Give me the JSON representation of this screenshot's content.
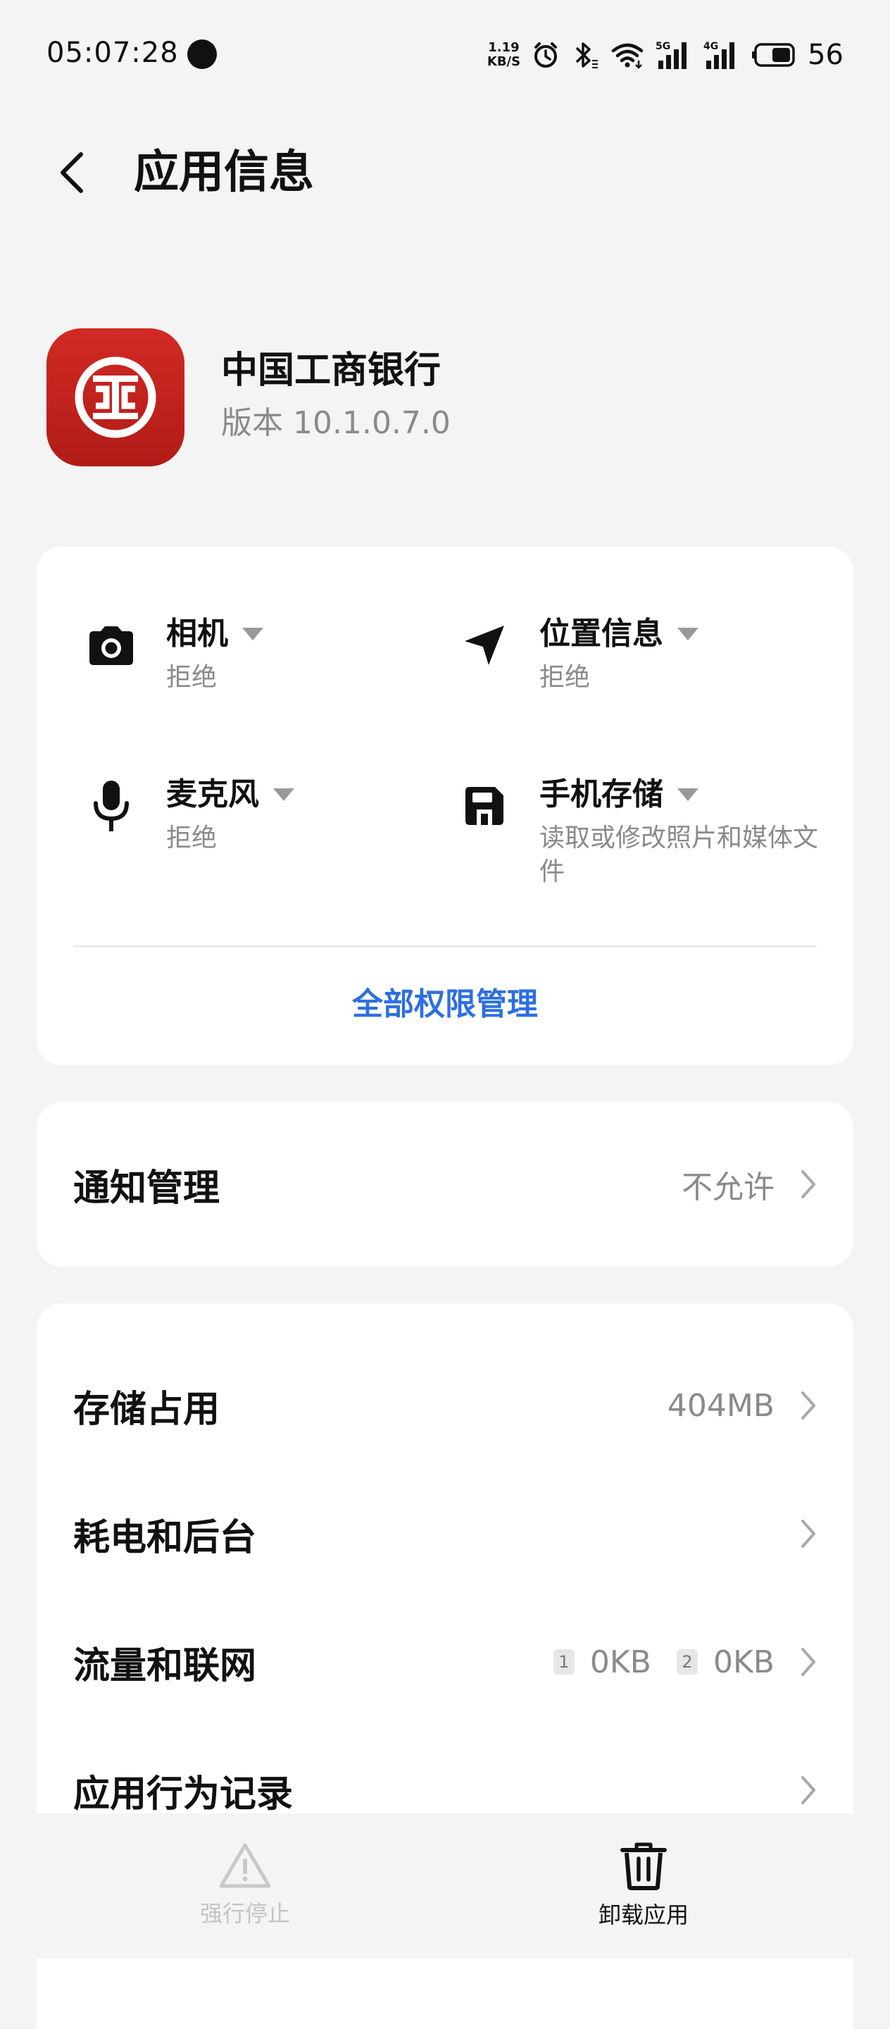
{
  "status_bar": {
    "time": "05:07:28",
    "net_speed_value": "1.19",
    "net_speed_unit": "KB/S",
    "signal1_label": "5G",
    "signal2_label": "4G",
    "battery": "56"
  },
  "header": {
    "title": "应用信息"
  },
  "app": {
    "name": "中国工商银行",
    "version": "版本 10.1.0.7.0"
  },
  "permissions": {
    "items": [
      {
        "name": "相机",
        "status": "拒绝",
        "icon": "camera-icon"
      },
      {
        "name": "位置信息",
        "status": "拒绝",
        "icon": "location-icon"
      },
      {
        "name": "麦克风",
        "status": "拒绝",
        "icon": "microphone-icon"
      },
      {
        "name": "手机存储",
        "status": "读取或修改照片和媒体文件",
        "icon": "storage-icon"
      }
    ],
    "manage_all_label": "全部权限管理"
  },
  "notification": {
    "label": "通知管理",
    "value": "不允许"
  },
  "settings": {
    "storage_label": "存储占用",
    "storage_value": "404MB",
    "battery_label": "耗电和后台",
    "traffic_label": "流量和联网",
    "sim1": "1",
    "sim1_value": "0KB",
    "sim2": "2",
    "sim2_value": "0KB",
    "behavior_label": "应用行为记录"
  },
  "bottom": {
    "force_stop_label": "强行停止",
    "force_stop_enabled": false,
    "uninstall_label": "卸载应用"
  },
  "colors": {
    "accent_blue": "#2d6fe0",
    "app_icon_red": "#c4221d"
  }
}
